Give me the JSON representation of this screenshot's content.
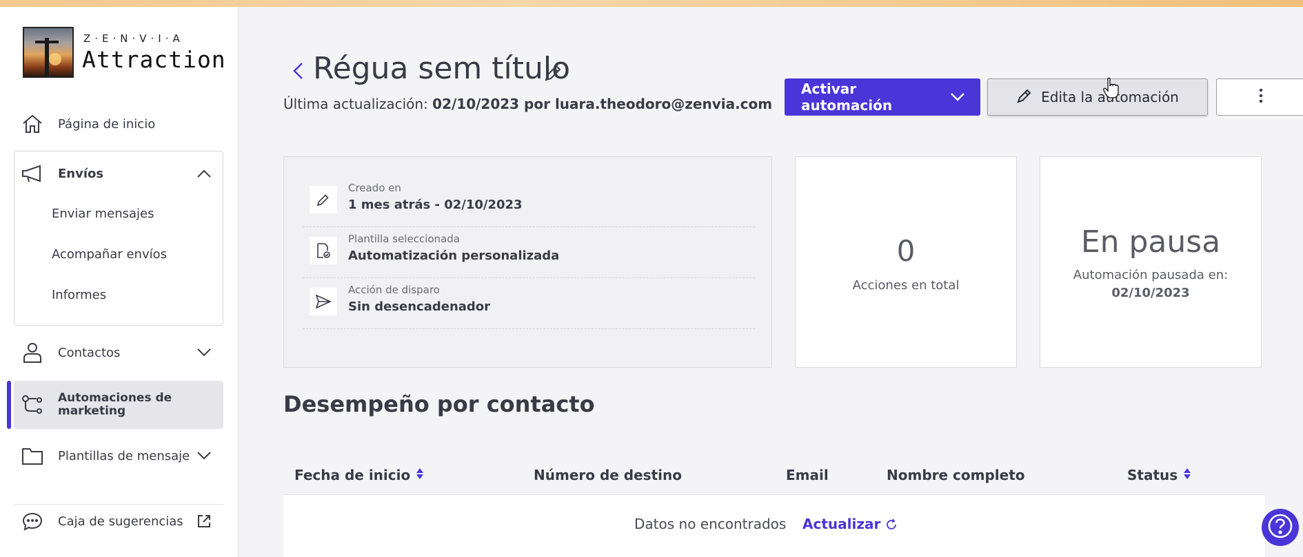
{
  "brand": {
    "company": "Z·E·N·V·I·A",
    "product": "Attraction"
  },
  "sidebar": {
    "home": "Página de inicio",
    "envios": {
      "label": "Envíos",
      "items": [
        "Enviar mensajes",
        "Acompañar envíos",
        "Informes"
      ]
    },
    "contacts": "Contactos",
    "automations": "Automaciones de marketing",
    "templates": "Plantillas de mensaje",
    "feedback": "Caja de sugerencias"
  },
  "header": {
    "title": "Régua sem título",
    "updated_prefix": "Última actualización:",
    "updated_value": "02/10/2023 por luara.theodoro@zenvia.com"
  },
  "actions": {
    "activate": "Activar automación",
    "edit": "Edita la automación"
  },
  "info": {
    "rows": [
      {
        "label": "Creado en",
        "value": "1 mes atrás - 02/10/2023",
        "icon": "pencil-icon"
      },
      {
        "label": "Plantilla seleccionada",
        "value": "Automatización personalizada",
        "icon": "template-icon"
      },
      {
        "label": "Acción de disparo",
        "value": "Sin desencadenador",
        "icon": "send-icon"
      }
    ]
  },
  "stats": {
    "actions_count": "0",
    "actions_label": "Acciones en total",
    "status": "En pausa",
    "paused_label": "Automación pausada en:",
    "paused_date": "02/10/2023"
  },
  "performance": {
    "title": "Desempeño por contacto",
    "columns": [
      "Fecha de inicio",
      "Número de destino",
      "Email",
      "Nombre completo",
      "Status"
    ],
    "empty": "Datos no encontrados",
    "refresh": "Actualizar"
  },
  "colors": {
    "accent": "#4a35d9",
    "text": "#3a3a46"
  }
}
